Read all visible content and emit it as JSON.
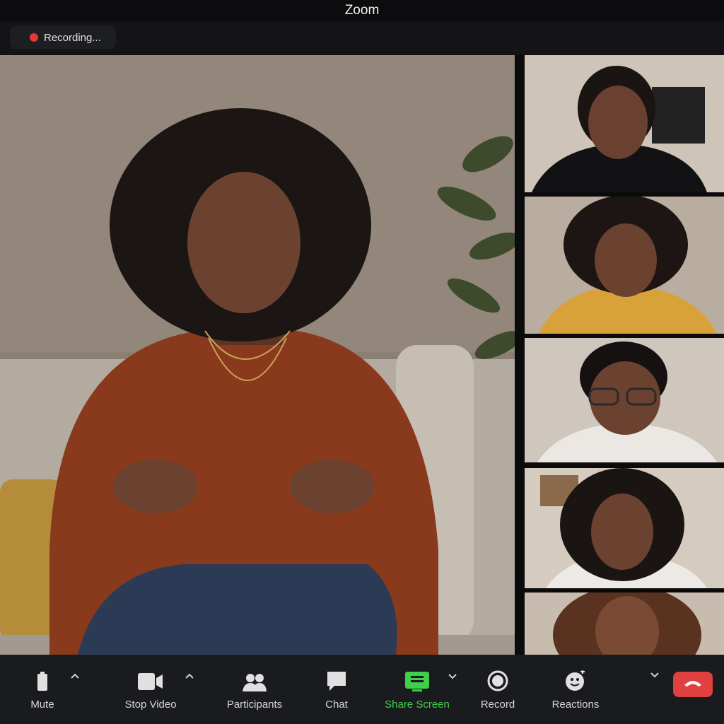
{
  "window": {
    "title": "Zoom"
  },
  "recording": {
    "label": "Recording..."
  },
  "toolbar": {
    "mute": "Mute",
    "stop_video": "Stop Video",
    "participants": "Participants",
    "chat": "Chat",
    "share_screen": "Share Screen",
    "record": "Record",
    "reactions": "Reactions"
  },
  "colors": {
    "recording_dot": "#e53935",
    "share_active": "#3fcf4a",
    "leave": "#e0403f"
  },
  "icons": [
    "microphone-icon",
    "camera-icon",
    "participants-icon",
    "chat-icon",
    "share-screen-icon",
    "record-icon",
    "reactions-icon",
    "end-call-icon",
    "chevron-up-icon",
    "chevron-down-icon"
  ]
}
